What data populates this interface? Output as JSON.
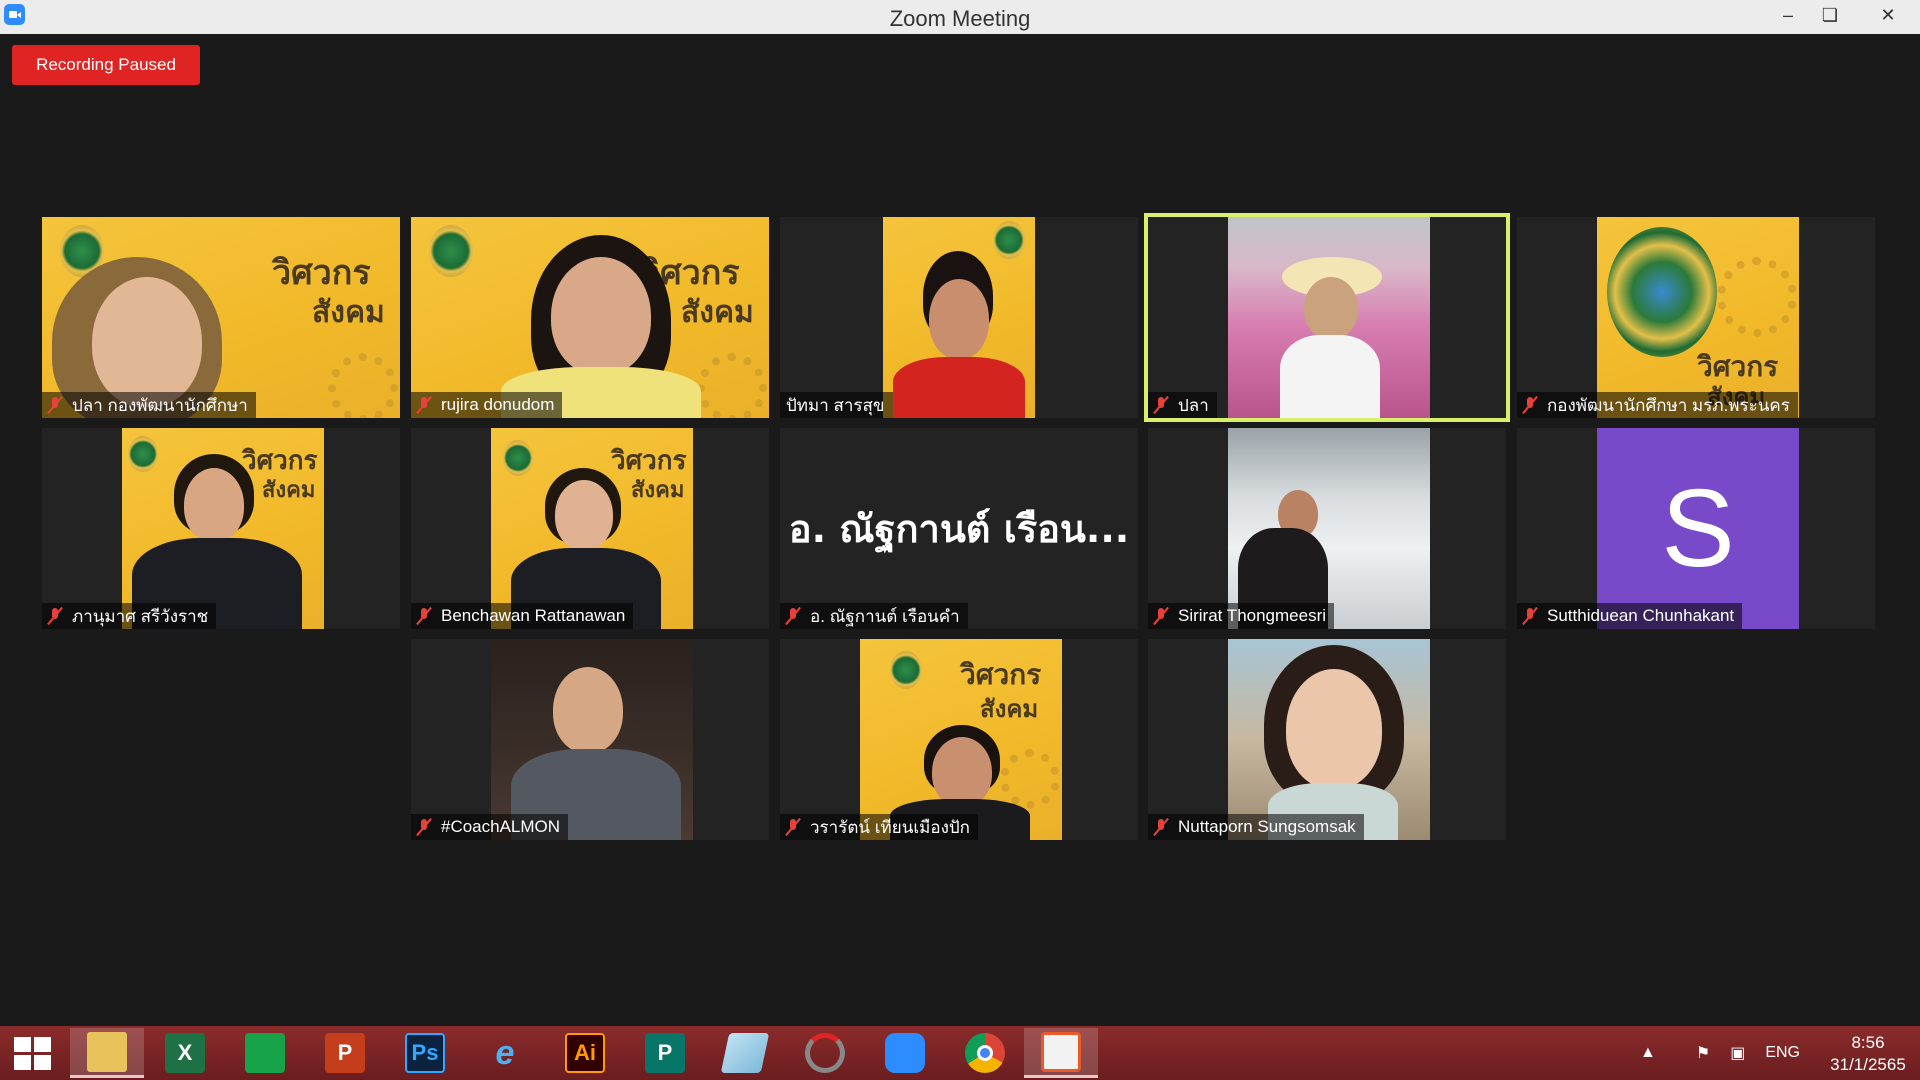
{
  "window": {
    "title": "Zoom Meeting",
    "minimize_glyph": "–",
    "maximize_glyph": "❏",
    "close_glyph": "✕"
  },
  "recording": {
    "label": "Recording Paused"
  },
  "participants": [
    {
      "name": "ปลา กองพัฒนานักศึกษา",
      "muted": true
    },
    {
      "name": "rujira donudom",
      "muted": true
    },
    {
      "name": "ปัทมา สารสุข",
      "muted": false
    },
    {
      "name": "ปลา",
      "muted": true,
      "active_speaker": true
    },
    {
      "name": "กองพัฒนานักศึกษา มรภ.พระนคร",
      "muted": true
    },
    {
      "name": "ภานุมาศ สรีวังราช",
      "muted": true
    },
    {
      "name": "Benchawan Rattanawan",
      "muted": true
    },
    {
      "name": "อ. ณัฐกานต์  เรือนคำ",
      "muted": true,
      "display_text": "อ. ณัฐกานต์  เรือน..."
    },
    {
      "name": "Sirirat Thongmeesri",
      "muted": true
    },
    {
      "name": "Sutthiduean Chunhakant",
      "muted": true,
      "initial": "S"
    },
    {
      "name": "#CoachALMON",
      "muted": true
    },
    {
      "name": "วรารัตน์ เทียนเมืองปัก",
      "muted": true
    },
    {
      "name": "Nuttaporn Sungsomsak",
      "muted": true
    }
  ],
  "banner_text": {
    "line1": "วิศวกร",
    "line2": "สังคม"
  },
  "taskbar": {
    "apps": [
      "file-explorer",
      "excel",
      "store",
      "powerpoint",
      "photoshop",
      "internet-explorer",
      "illustrator",
      "publisher",
      "notepad",
      "photoscape",
      "zoom",
      "chrome",
      "photos"
    ],
    "labels": {
      "excel": "X",
      "photoshop": "Ps",
      "illustrator": "Ai",
      "powerpoint": "P",
      "publisher": "P"
    },
    "language": "ENG",
    "time": "8:56",
    "date": "31/1/2565"
  },
  "colors": {
    "recording_red": "#e02424",
    "active_speaker_border": "#d8f06a",
    "avatar_purple": "#7849c8",
    "banner_yellow": "#f1b929"
  }
}
